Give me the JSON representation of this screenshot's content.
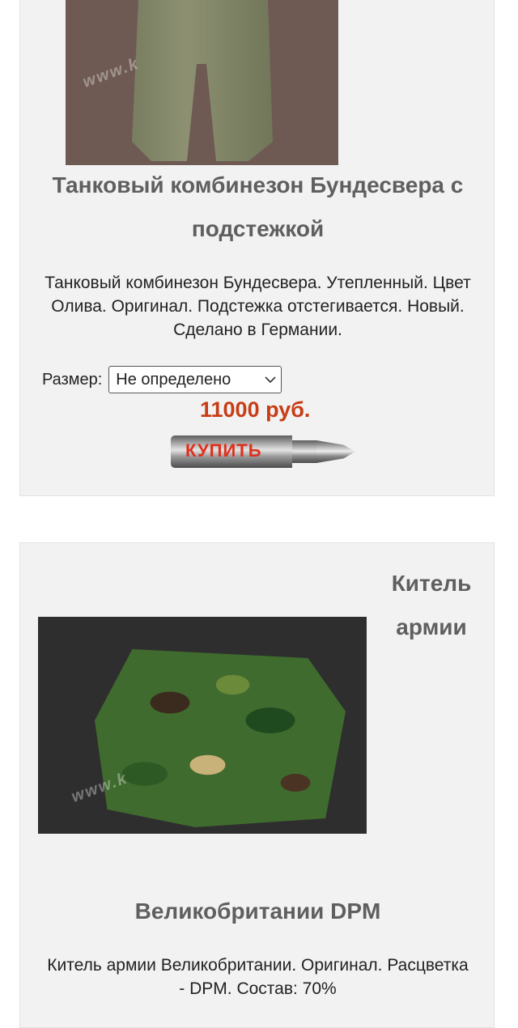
{
  "products": [
    {
      "title": "Танковый комбинезон Бундесвера с подстежкой",
      "description": "Танковый комбинезон Бундесвера. Утепленный. Цвет Олива. Оригинал. Подстежка отстегивается. Новый. Сделано в Германии.",
      "size_label": "Размер:",
      "size_value": "Не определено",
      "price": "11000 руб.",
      "buy_label": "КУПИТЬ",
      "image_watermark": "www.k"
    },
    {
      "title_top": "Китель армии",
      "title_bottom": "Великобритании DPM",
      "description": "Китель армии Великобритании. Оригинал. Расцветка - DPM. Состав: 70%",
      "image_watermark": "www.k"
    }
  ],
  "colors": {
    "price": "#c73d16",
    "title": "#5f5f5f",
    "card_bg": "#f2f2f2",
    "buy_label": "#e0301e"
  }
}
